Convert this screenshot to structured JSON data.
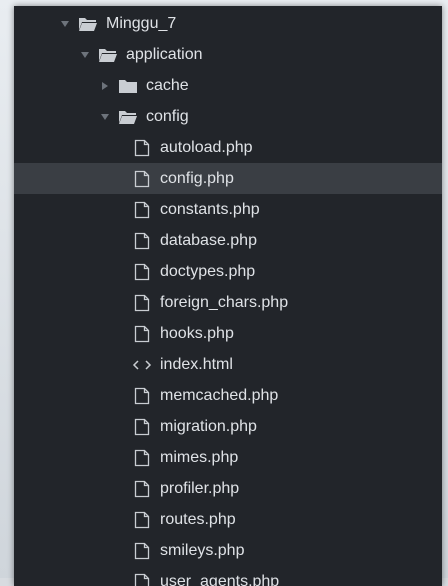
{
  "tree": {
    "items": [
      {
        "label": "Minggu_7",
        "kind": "folder",
        "state": "open",
        "depth": 0,
        "selected": false
      },
      {
        "label": "application",
        "kind": "folder",
        "state": "open",
        "depth": 1,
        "selected": false
      },
      {
        "label": "cache",
        "kind": "folder",
        "state": "closed",
        "depth": 2,
        "selected": false
      },
      {
        "label": "config",
        "kind": "folder",
        "state": "open",
        "depth": 2,
        "selected": false
      },
      {
        "label": "autoload.php",
        "kind": "file",
        "depth": 3,
        "selected": false
      },
      {
        "label": "config.php",
        "kind": "file",
        "depth": 3,
        "selected": true
      },
      {
        "label": "constants.php",
        "kind": "file",
        "depth": 3,
        "selected": false
      },
      {
        "label": "database.php",
        "kind": "file",
        "depth": 3,
        "selected": false
      },
      {
        "label": "doctypes.php",
        "kind": "file",
        "depth": 3,
        "selected": false
      },
      {
        "label": "foreign_chars.php",
        "kind": "file",
        "depth": 3,
        "selected": false
      },
      {
        "label": "hooks.php",
        "kind": "file",
        "depth": 3,
        "selected": false
      },
      {
        "label": "index.html",
        "kind": "code",
        "depth": 3,
        "selected": false
      },
      {
        "label": "memcached.php",
        "kind": "file",
        "depth": 3,
        "selected": false
      },
      {
        "label": "migration.php",
        "kind": "file",
        "depth": 3,
        "selected": false
      },
      {
        "label": "mimes.php",
        "kind": "file",
        "depth": 3,
        "selected": false
      },
      {
        "label": "profiler.php",
        "kind": "file",
        "depth": 3,
        "selected": false
      },
      {
        "label": "routes.php",
        "kind": "file",
        "depth": 3,
        "selected": false
      },
      {
        "label": "smileys.php",
        "kind": "file",
        "depth": 3,
        "selected": false
      },
      {
        "label": "user_agents.php",
        "kind": "file",
        "depth": 3,
        "selected": false
      }
    ]
  },
  "colors": {
    "background": "#22252a",
    "selected": "#3a3e44",
    "text": "#dfe2e6",
    "icon": "#c9cdd2",
    "arrow": "#6d737b"
  }
}
